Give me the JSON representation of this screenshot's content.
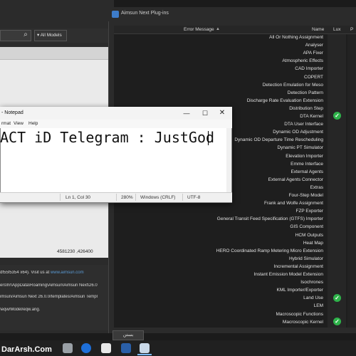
{
  "main_window": {
    "filter_label": "All Models",
    "coordinates": "4581230 ,426400",
    "log": {
      "line1_prefix": "df55f5354 x64). Visit us at ",
      "line1_link": "www.aimsun.com",
      "line2": "ers\\hr\\AppData\\Roaming\\Aimsun\\Aimsun Next\\26.0",
      "line3": "imsun/Aimsun Next 26.0.0/templates/Aimsun Templ",
      "line4": "\\eqw/Model/eqw.ang."
    }
  },
  "plugins_window": {
    "title": "Aimsun Next Plug-ins",
    "columns": {
      "error": "Error Message",
      "name": "Name",
      "lux": "Lux",
      "p": "P"
    },
    "items": [
      "All Or Nothing Assignment",
      "Analyser",
      "APA Fixer",
      "Atmospheric Effects",
      "CAD Importer",
      "COPERT",
      "Detection Emulation for Meso",
      "Detection Pattern",
      "Discharge Rate Evaluation Extension",
      "Distribution Step",
      "DTA Kernel",
      "DTA User Interface",
      "Dynamic OD Adjustment",
      "Dynamic OD Departure Time Rescheduling",
      "Dynamic PT Simulator",
      "Elevation Importer",
      "Emme Interface",
      "External Agents",
      "External Agents Connector",
      "Extras",
      "Four-Step Model",
      "Frank and Wolfe Assignment",
      "FZP Exporter",
      "General Transit Feed Specification (GTFS) Importer",
      "GIS Component",
      "HCM Outputs",
      "Heat Map",
      "HERO Coordinated Ramp Metering Micro Extension",
      "Hybrid Simulator",
      "Incremental Assignment",
      "Instant Emission Model Extension",
      "Isochrones",
      "KML Importer/Exporter",
      "Land Use",
      "LEM",
      "Macroscopic Functions",
      "Macroscopic Kernel"
    ],
    "footer_button": "بستن",
    "check_color": "#2eb34a"
  },
  "notepad": {
    "title": "- Notepad",
    "menu": {
      "format": "rmat",
      "view": "View",
      "help": "Help"
    },
    "content": "ACT iD Telegram : JustGod",
    "status": {
      "position": "Ln 1, Col 30",
      "zoom": "280%",
      "line_endings": "Windows (CRLF)",
      "encoding": "UTF-8"
    }
  },
  "taskbar": {
    "watermark": "DarArsh.Com"
  }
}
